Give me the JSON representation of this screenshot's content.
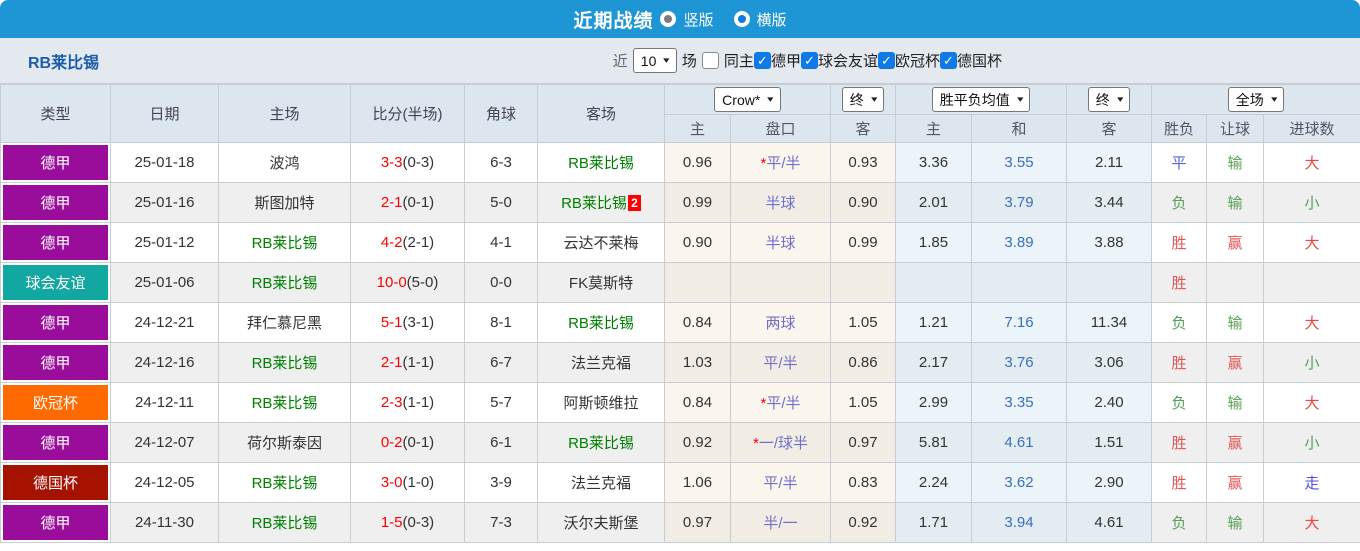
{
  "topbar": {
    "title": "近期战绩",
    "vertical_label": "竖版",
    "horizontal_label": "横版",
    "selected_layout": "横版"
  },
  "filterbar": {
    "team": "RB莱比锡",
    "recent_label": "近",
    "recent_count": "10",
    "matches_label": "场",
    "same_home_label": "同主",
    "same_home_checked": false,
    "league_filters": [
      {
        "label": "德甲",
        "checked": true
      },
      {
        "label": "球会友谊",
        "checked": true
      },
      {
        "label": "欧冠杯",
        "checked": true
      },
      {
        "label": "德国杯",
        "checked": true
      }
    ]
  },
  "table": {
    "selects": {
      "odds_company": "Crow*",
      "odds_final": "终",
      "mean_label": "胜平负均值",
      "mean_final": "终",
      "scope": "全场"
    },
    "main_headers": [
      "类型",
      "日期",
      "主场",
      "比分(半场)",
      "角球",
      "客场"
    ],
    "odds_headers": [
      "主",
      "盘口",
      "客"
    ],
    "mean_headers": [
      "主",
      "和",
      "客"
    ],
    "result_headers": [
      "胜负",
      "让球",
      "进球数"
    ],
    "colors": {
      "topbar_blue": "#1e95d4",
      "league_dejia": "#9a0d9a",
      "league_friendly": "#12a7a0",
      "league_ucl": "#ff6a00",
      "league_decup": "#a51200",
      "team_highlight_green": "#008000",
      "score_red": "#ff0000",
      "handicap_violet": "#7070cc",
      "mean_draw_blue": "#3a6fc0",
      "win_red": "#e25555",
      "lose_green": "#55a055",
      "draw_blue": "#5566dd",
      "void_blue": "#5050e0"
    },
    "rows": [
      {
        "league": "德甲",
        "league_cls": "dejia",
        "date": "25-01-18",
        "home": "波鸿",
        "home_rb": false,
        "score": "3-3",
        "half": "(0-3)",
        "corners": "6-3",
        "away": "RB莱比锡",
        "away_rb": true,
        "red_cards": "",
        "odds_home": "0.96",
        "handicap_star": true,
        "handicap": "平/半",
        "odds_away": "0.93",
        "mean_home": "3.36",
        "mean_draw": "3.55",
        "mean_away": "2.11",
        "result": "平",
        "result_cls": "draw",
        "handicap_result": "输",
        "handicap_result_cls": "lose",
        "goals": "大",
        "goals_cls": "high"
      },
      {
        "league": "德甲",
        "league_cls": "dejia",
        "date": "25-01-16",
        "home": "斯图加特",
        "home_rb": false,
        "score": "2-1",
        "half": "(0-1)",
        "corners": "5-0",
        "away": "RB莱比锡",
        "away_rb": true,
        "red_cards": "2",
        "odds_home": "0.99",
        "handicap_star": false,
        "handicap": "半球",
        "odds_away": "0.90",
        "mean_home": "2.01",
        "mean_draw": "3.79",
        "mean_away": "3.44",
        "result": "负",
        "result_cls": "lose",
        "handicap_result": "输",
        "handicap_result_cls": "lose",
        "goals": "小",
        "goals_cls": "low"
      },
      {
        "league": "德甲",
        "league_cls": "dejia",
        "date": "25-01-12",
        "home": "RB莱比锡",
        "home_rb": true,
        "score": "4-2",
        "half": "(2-1)",
        "corners": "4-1",
        "away": "云达不莱梅",
        "away_rb": false,
        "red_cards": "",
        "odds_home": "0.90",
        "handicap_star": false,
        "handicap": "半球",
        "odds_away": "0.99",
        "mean_home": "1.85",
        "mean_draw": "3.89",
        "mean_away": "3.88",
        "result": "胜",
        "result_cls": "win",
        "handicap_result": "赢",
        "handicap_result_cls": "win",
        "goals": "大",
        "goals_cls": "high"
      },
      {
        "league": "球会友谊",
        "league_cls": "friendly",
        "date": "25-01-06",
        "home": "RB莱比锡",
        "home_rb": true,
        "score": "10-0",
        "half": "(5-0)",
        "corners": "0-0",
        "away": "FK莫斯特",
        "away_rb": false,
        "red_cards": "",
        "odds_home": "",
        "handicap_star": false,
        "handicap": "",
        "odds_away": "",
        "mean_home": "",
        "mean_draw": "",
        "mean_away": "",
        "result": "胜",
        "result_cls": "win",
        "handicap_result": "",
        "handicap_result_cls": "",
        "goals": "",
        "goals_cls": ""
      },
      {
        "league": "德甲",
        "league_cls": "dejia",
        "date": "24-12-21",
        "home": "拜仁慕尼黑",
        "home_rb": false,
        "score": "5-1",
        "half": "(3-1)",
        "corners": "8-1",
        "away": "RB莱比锡",
        "away_rb": true,
        "red_cards": "",
        "odds_home": "0.84",
        "handicap_star": false,
        "handicap": "两球",
        "odds_away": "1.05",
        "mean_home": "1.21",
        "mean_draw": "7.16",
        "mean_away": "11.34",
        "result": "负",
        "result_cls": "lose",
        "handicap_result": "输",
        "handicap_result_cls": "lose",
        "goals": "大",
        "goals_cls": "high"
      },
      {
        "league": "德甲",
        "league_cls": "dejia",
        "date": "24-12-16",
        "home": "RB莱比锡",
        "home_rb": true,
        "score": "2-1",
        "half": "(1-1)",
        "corners": "6-7",
        "away": "法兰克福",
        "away_rb": false,
        "red_cards": "",
        "odds_home": "1.03",
        "handicap_star": false,
        "handicap": "平/半",
        "odds_away": "0.86",
        "mean_home": "2.17",
        "mean_draw": "3.76",
        "mean_away": "3.06",
        "result": "胜",
        "result_cls": "win",
        "handicap_result": "赢",
        "handicap_result_cls": "win",
        "goals": "小",
        "goals_cls": "low"
      },
      {
        "league": "欧冠杯",
        "league_cls": "ucl",
        "date": "24-12-11",
        "home": "RB莱比锡",
        "home_rb": true,
        "score": "2-3",
        "half": "(1-1)",
        "corners": "5-7",
        "away": "阿斯顿维拉",
        "away_rb": false,
        "red_cards": "",
        "odds_home": "0.84",
        "handicap_star": true,
        "handicap": "平/半",
        "odds_away": "1.05",
        "mean_home": "2.99",
        "mean_draw": "3.35",
        "mean_away": "2.40",
        "result": "负",
        "result_cls": "lose",
        "handicap_result": "输",
        "handicap_result_cls": "lose",
        "goals": "大",
        "goals_cls": "high"
      },
      {
        "league": "德甲",
        "league_cls": "dejia",
        "date": "24-12-07",
        "home": "荷尔斯泰因",
        "home_rb": false,
        "score": "0-2",
        "half": "(0-1)",
        "corners": "6-1",
        "away": "RB莱比锡",
        "away_rb": true,
        "red_cards": "",
        "odds_home": "0.92",
        "handicap_star": true,
        "handicap": "一/球半",
        "odds_away": "0.97",
        "mean_home": "5.81",
        "mean_draw": "4.61",
        "mean_away": "1.51",
        "result": "胜",
        "result_cls": "win",
        "handicap_result": "赢",
        "handicap_result_cls": "win",
        "goals": "小",
        "goals_cls": "low"
      },
      {
        "league": "德国杯",
        "league_cls": "decup",
        "date": "24-12-05",
        "home": "RB莱比锡",
        "home_rb": true,
        "score": "3-0",
        "half": "(1-0)",
        "corners": "3-9",
        "away": "法兰克福",
        "away_rb": false,
        "red_cards": "",
        "odds_home": "1.06",
        "handicap_star": false,
        "handicap": "平/半",
        "odds_away": "0.83",
        "mean_home": "2.24",
        "mean_draw": "3.62",
        "mean_away": "2.90",
        "result": "胜",
        "result_cls": "win",
        "handicap_result": "赢",
        "handicap_result_cls": "win",
        "goals": "走",
        "goals_cls": "void"
      },
      {
        "league": "德甲",
        "league_cls": "dejia",
        "date": "24-11-30",
        "home": "RB莱比锡",
        "home_rb": true,
        "score": "1-5",
        "half": "(0-3)",
        "corners": "7-3",
        "away": "沃尔夫斯堡",
        "away_rb": false,
        "red_cards": "",
        "odds_home": "0.97",
        "handicap_star": false,
        "handicap": "半/一",
        "odds_away": "0.92",
        "mean_home": "1.71",
        "mean_draw": "3.94",
        "mean_away": "4.61",
        "result": "负",
        "result_cls": "lose",
        "handicap_result": "输",
        "handicap_result_cls": "lose",
        "goals": "大",
        "goals_cls": "high"
      }
    ]
  }
}
